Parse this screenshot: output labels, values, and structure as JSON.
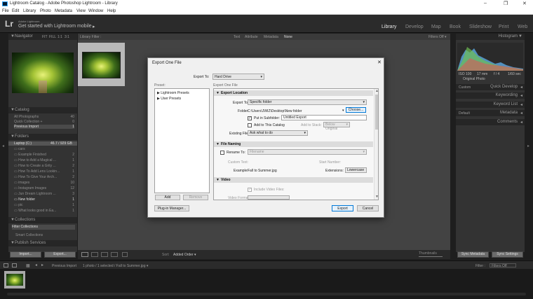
{
  "window": {
    "title": "Lightroom Catalog - Adobe Photoshop Lightroom - Library",
    "controls": [
      "–",
      "❐",
      "✕"
    ]
  },
  "menu": [
    "File",
    "Edit",
    "Library",
    "Photo",
    "Metadata",
    "View",
    "Window",
    "Help"
  ],
  "identity": {
    "logo": "Lr",
    "line1": "Adobe Lightroom",
    "line2": "Get started with Lightroom mobile",
    "arrow": "▸"
  },
  "modules": [
    "Library",
    "Develop",
    "Map",
    "Book",
    "Slideshow",
    "Print",
    "Web"
  ],
  "navigator": {
    "title": "Navigator",
    "zoom": [
      "FIT",
      "FILL",
      "1:1",
      "3:1"
    ]
  },
  "catalog": {
    "title": "Catalog",
    "items": [
      {
        "label": "All Photographs",
        "count": "40"
      },
      {
        "label": "Quick Collection +",
        "count": "0"
      },
      {
        "label": "Previous Import",
        "count": "1"
      }
    ]
  },
  "folders": {
    "title": "Folders",
    "volume": "Laptop (C:)",
    "volume_info": "46.7 / 929 GB",
    "items": [
      {
        "label": "cars",
        "count": ""
      },
      {
        "label": "Example Finished",
        "count": "2"
      },
      {
        "label": "How to Add a Magical ...",
        "count": "1"
      },
      {
        "label": "How to Create a Grity ...",
        "count": "2"
      },
      {
        "label": "How To Add Lens Lookin...",
        "count": "1"
      },
      {
        "label": "How To Give Your Arch...",
        "count": "2"
      },
      {
        "label": "images",
        "count": "10"
      },
      {
        "label": "Instagram Images",
        "count": "12"
      },
      {
        "label": "Jun Dream Lightroom ...",
        "count": "3"
      },
      {
        "label": "New folder",
        "count": "1"
      },
      {
        "label": "pic",
        "count": "1"
      },
      {
        "label": "What looks good in Ea...",
        "count": "1"
      }
    ]
  },
  "collections": {
    "title": "Collections",
    "items": [
      "Filter Collections",
      "Smart Collections"
    ]
  },
  "publish": {
    "title": "Publish Services"
  },
  "left_buttons": {
    "import": "Import...",
    "export": "Export..."
  },
  "filter_bar": {
    "label": "Library Filter :",
    "options": [
      "Text",
      "Attribute",
      "Metadata",
      "None"
    ],
    "preset": "Filters Off ▾"
  },
  "toolbar": {
    "sort_label": "Sort:",
    "sort_value": "Added Order ▾",
    "thumbnails": "Thumbnails"
  },
  "histogram": {
    "title": "Histogram",
    "iso": "ISO 100",
    "focal": "17 mm",
    "aperture": "f / 4",
    "shutter": "1/60 sec",
    "original": "Original Photo"
  },
  "right_panels": {
    "quick_develop": "Quick Develop",
    "saved_preset": "Custom",
    "keywording": "Keywording",
    "keyword_list": "Keyword List",
    "metadata": "Metadata",
    "metadata_preset": "Default",
    "comments": "Comments"
  },
  "right_buttons": {
    "sync_metadata": "Sync Metadata",
    "sync_settings": "Sync Settings"
  },
  "filmstrip": {
    "source": "Previous Import",
    "info": "1 photo / 1 selected / Fall to Summer.jpg ▾",
    "filter_label": "Filter :",
    "filter_value": "Filters Off"
  },
  "dialog": {
    "title": "Export One File",
    "export_to_label": "Export To:",
    "export_to_value": "Hard Drive",
    "preset_header": "Preset:",
    "export_file_header": "Export One File",
    "presets": [
      "Lightroom Presets",
      "User Presets"
    ],
    "add": "Add",
    "remove": "Remove",
    "sections": {
      "location": "Export Location",
      "naming": "File Naming",
      "video": "Video"
    },
    "location": {
      "export_to_label": "Export To:",
      "export_to_value": "Specific folder",
      "folder_label": "Folder:",
      "folder_value": "C:\\Users\\JWIZ\\Desktop\\New folder",
      "choose": "Choose...",
      "subfolder_label": "Put in Subfolder:",
      "subfolder_value": "Untitled Export",
      "add_catalog": "Add to This Catalog",
      "add_stack": "Add to Stack:",
      "stack_value": "Below Original",
      "existing_label": "Existing Files:",
      "existing_value": "Ask what to do"
    },
    "naming": {
      "rename_label": "Rename To:",
      "rename_value": "Filename",
      "custom_text": "Custom Text:",
      "start_number": "Start Number:",
      "example_label": "Example:",
      "example_value": "Fall to Summer.jpg",
      "extensions_label": "Extensions:",
      "extensions_value": "Lowercase"
    },
    "video": {
      "include": "Include Video Files:",
      "format": "Video Format:"
    },
    "plugin_manager": "Plug-in Manager...",
    "export": "Export",
    "cancel": "Cancel"
  }
}
